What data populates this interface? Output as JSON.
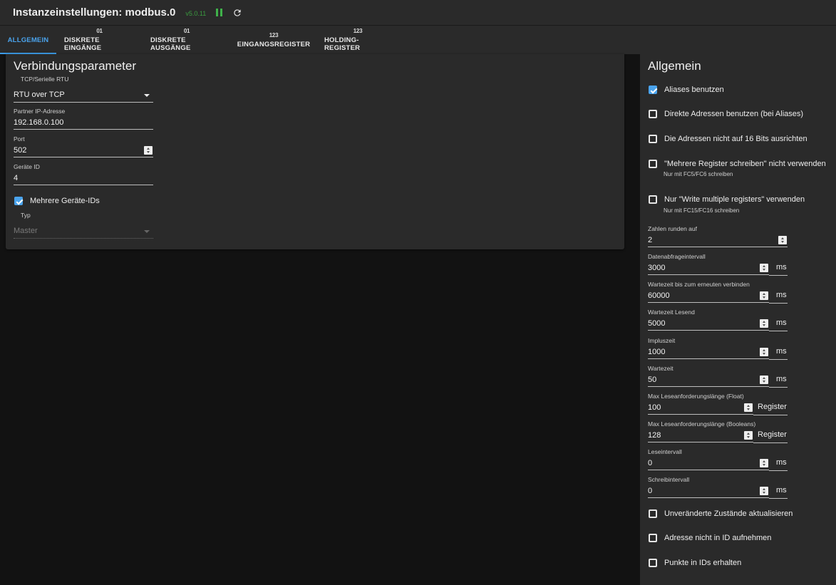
{
  "header": {
    "title": "Instanzeinstellungen: modbus.0",
    "version": "v5.0.11"
  },
  "tabs": [
    {
      "icon": "",
      "label": "ALLGEMEIN"
    },
    {
      "icon": "01",
      "label": "DISKRETE EINGÄNGE"
    },
    {
      "icon": "01",
      "label": "DISKRETE AUSGÄNGE"
    },
    {
      "icon": "123",
      "label": "EINGANGSREGISTER"
    },
    {
      "icon": "123",
      "label": "HOLDING-REGISTER"
    }
  ],
  "connection": {
    "heading": "Verbindungsparameter",
    "type_label": "TCP/Serielle RTU",
    "type_value": "RTU over TCP",
    "ip_label": "Partner IP-Adresse",
    "ip_value": "192.168.0.100",
    "port_label": "Port",
    "port_value": "502",
    "device_label": "Geräte ID",
    "device_value": "4",
    "multi_label": "Mehrere Geräte-IDs",
    "typ_label": "Typ",
    "typ_value": "Master"
  },
  "general": {
    "heading": "Allgemein",
    "checks_top": [
      {
        "label": "Aliases benutzen",
        "checked": true,
        "help": ""
      },
      {
        "label": "Direkte Adressen benutzen (bei Aliases)",
        "checked": false,
        "help": ""
      },
      {
        "label": "Die Adressen nicht auf 16 Bits ausrichten",
        "checked": false,
        "help": ""
      },
      {
        "label": "\"Mehrere Register schreiben\" nicht verwenden",
        "checked": false,
        "help": "Nur mit FC5/FC6 schreiben"
      },
      {
        "label": "Nur \"Write multiple registers\" verwenden",
        "checked": false,
        "help": "Nur mit FC15/FC16 schreiben"
      }
    ],
    "fields": [
      {
        "label": "Zahlen runden auf",
        "value": "2",
        "unit": ""
      },
      {
        "label": "Datenabfrageintervall",
        "value": "3000",
        "unit": "ms"
      },
      {
        "label": "Wartezeit bis zum erneuten verbinden",
        "value": "60000",
        "unit": "ms"
      },
      {
        "label": "Wartezeit Lesend",
        "value": "5000",
        "unit": "ms"
      },
      {
        "label": "Impluszeit",
        "value": "1000",
        "unit": "ms"
      },
      {
        "label": "Wartezeit",
        "value": "50",
        "unit": "ms"
      },
      {
        "label": "Max Leseanforderungslänge (Float)",
        "value": "100",
        "unit": "Register"
      },
      {
        "label": "Max Leseanforderungslänge (Booleans)",
        "value": "128",
        "unit": "Register"
      },
      {
        "label": "Leseintervall",
        "value": "0",
        "unit": "ms"
      },
      {
        "label": "Schreibintervall",
        "value": "0",
        "unit": "ms"
      }
    ],
    "checks_bottom": [
      {
        "label": "Unveränderte Zustände aktualisieren",
        "checked": false
      },
      {
        "label": "Adresse nicht in ID aufnehmen",
        "checked": false
      },
      {
        "label": "Punkte in IDs erhalten",
        "checked": false
      }
    ]
  }
}
